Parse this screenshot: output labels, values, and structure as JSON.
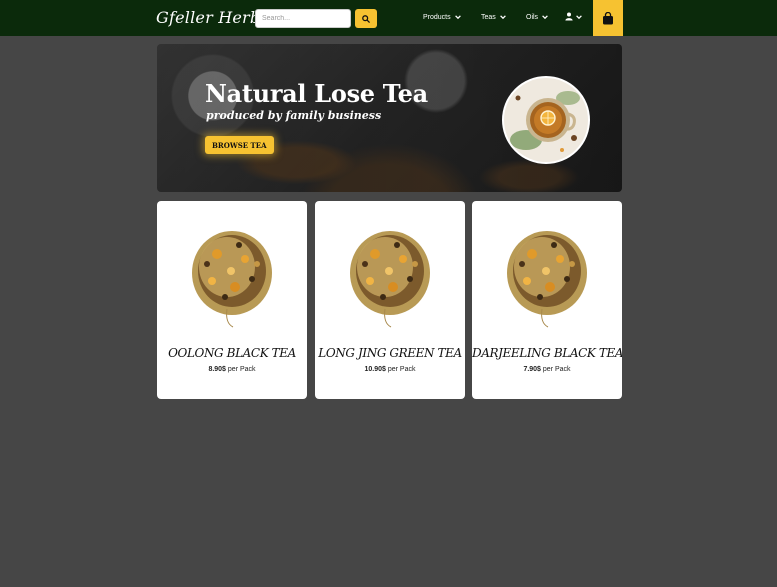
{
  "brand": {
    "logo_text": "Gfeller Herbs"
  },
  "search": {
    "placeholder": "Search...",
    "value": ""
  },
  "nav": {
    "items": [
      {
        "label": "Products"
      },
      {
        "label": "Teas"
      },
      {
        "label": "Oils"
      }
    ]
  },
  "icons": {
    "search": "search-icon",
    "chevron": "chevron-down-icon",
    "user": "user-icon",
    "cart": "shopping-bag-icon"
  },
  "colors": {
    "navbar_bg": "#0b2a0b",
    "accent": "#f6c231",
    "page_bg": "#464646",
    "card_bg": "#ffffff"
  },
  "hero": {
    "title": "Natural Lose Tea",
    "subtitle": "produced by family business",
    "button_label": "BROWSE TEA"
  },
  "products": [
    {
      "name": "OOLONG BLACK TEA",
      "price": "8.90$",
      "unit": " per Pack"
    },
    {
      "name": "LONG JING GREEN TEA",
      "price": "10.90$",
      "unit": " per Pack"
    },
    {
      "name": "DARJEELING BLACK TEA",
      "price": "7.90$",
      "unit": " per Pack"
    }
  ]
}
